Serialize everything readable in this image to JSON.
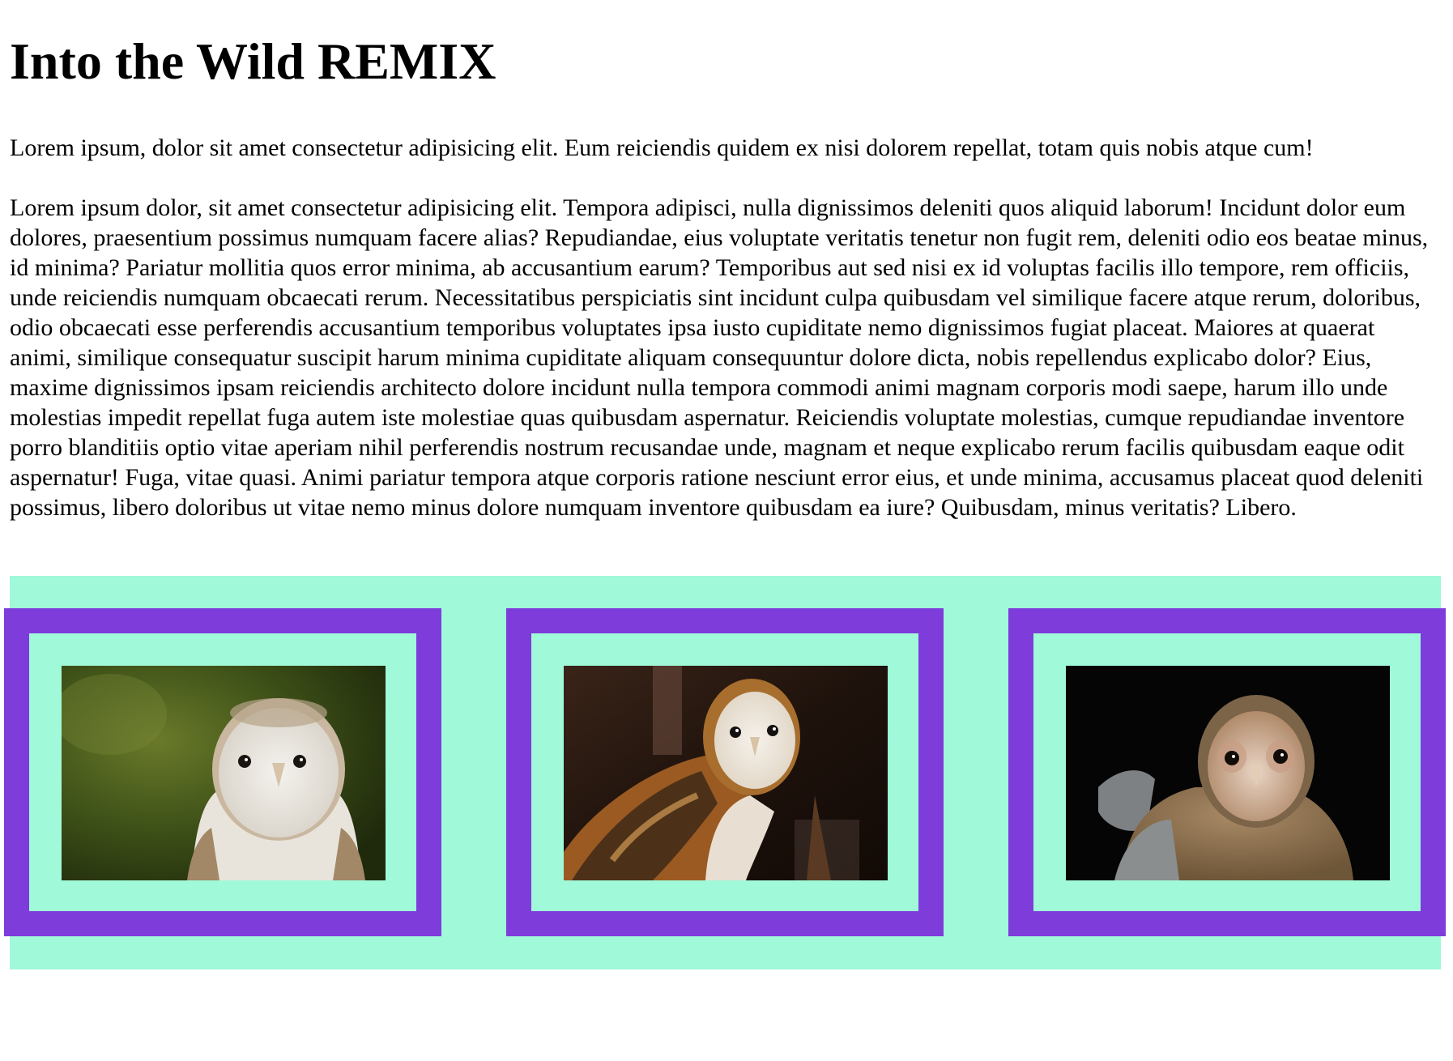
{
  "header": {
    "title": "Into the Wild REMIX"
  },
  "content": {
    "lead": "Lorem ipsum, dolor sit amet consectetur adipisicing elit. Eum reiciendis quidem ex nisi dolorem repellat, totam quis nobis atque cum!",
    "body": "Lorem ipsum dolor, sit amet consectetur adipisicing elit. Tempora adipisci, nulla dignissimos deleniti quos aliquid laborum! Incidunt dolor eum dolores, praesentium possimus numquam facere alias? Repudiandae, eius voluptate veritatis tenetur non fugit rem, deleniti odio eos beatae minus, id minima? Pariatur mollitia quos error minima, ab accusantium earum? Temporibus aut sed nisi ex id voluptas facilis illo tempore, rem officiis, unde reiciendis numquam obcaecati rerum. Necessitatibus perspiciatis sint incidunt culpa quibusdam vel similique facere atque rerum, doloribus, odio obcaecati esse perferendis accusantium temporibus voluptates ipsa iusto cupiditate nemo dignissimos fugiat placeat. Maiores at quaerat animi, similique consequatur suscipit harum minima cupiditate aliquam consequuntur dolore dicta, nobis repellendus explicabo dolor? Eius, maxime dignissimos ipsam reiciendis architecto dolore incidunt nulla tempora commodi animi magnam corporis modi saepe, harum illo unde molestias impedit repellat fuga autem iste molestiae quas quibusdam aspernatur. Reiciendis voluptate molestias, cumque repudiandae inventore porro blanditiis optio vitae aperiam nihil perferendis nostrum recusandae unde, magnam et neque explicabo rerum facilis quibusdam eaque odit aspernatur! Fuga, vitae quasi. Animi pariatur tempora atque corporis ratione nesciunt error eius, et unde minima, accusamus placeat quod deleniti possimus, libero doloribus ut vitae nemo minus dolore numquam inventore quibusdam ea iure? Quibusdam, minus veritatis? Libero."
  },
  "gallery": {
    "colors": {
      "background": "#a0f9d8",
      "frame_border": "#7e3cdb"
    },
    "images": [
      {
        "icon": "barn-owl-white-photo"
      },
      {
        "icon": "barn-owl-perched-photo"
      },
      {
        "icon": "barn-owl-dark-photo"
      }
    ]
  }
}
